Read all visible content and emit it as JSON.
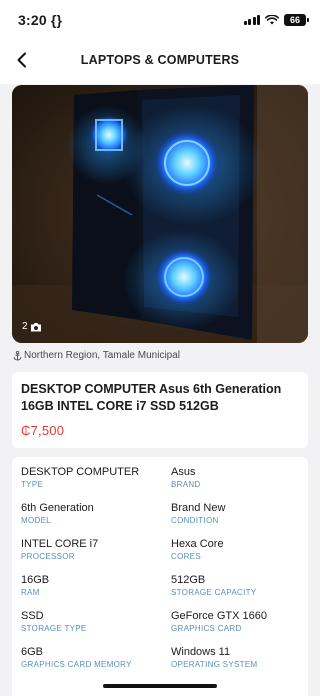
{
  "status_bar": {
    "time": "3:20 {}",
    "battery": "66"
  },
  "header": {
    "title": "LAPTOPS & COMPUTERS",
    "back_icon": "chevron-left-icon"
  },
  "photo": {
    "count": "2",
    "camera_icon": "camera-icon"
  },
  "location": {
    "text": "Northern Region, Tamale Municipal",
    "icon": "location-anchor-icon"
  },
  "listing": {
    "title": "DESKTOP COMPUTER Asus 6th Generation 16GB INTEL CORE i7 SSD 512GB",
    "price": "₵7,500",
    "price_color": "#e53935"
  },
  "specs": [
    {
      "value": "DESKTOP COMPUTER",
      "label": "TYPE"
    },
    {
      "value": "Asus",
      "label": "BRAND"
    },
    {
      "value": "6th Generation",
      "label": "MODEL"
    },
    {
      "value": "Brand New",
      "label": "CONDITION"
    },
    {
      "value": "INTEL CORE i7",
      "label": "PROCESSOR"
    },
    {
      "value": "Hexa Core",
      "label": "CORES"
    },
    {
      "value": "16GB",
      "label": "RAM"
    },
    {
      "value": "512GB",
      "label": "STORAGE CAPACITY"
    },
    {
      "value": "SSD",
      "label": "STORAGE TYPE"
    },
    {
      "value": "GeForce GTX 1660",
      "label": "GRAPHICS CARD"
    },
    {
      "value": "6GB",
      "label": "GRAPHICS CARD MEMORY"
    },
    {
      "value": "Windows 11",
      "label": "OPERATING SYSTEM"
    }
  ],
  "colors": {
    "accent_label": "#5a8fc0",
    "background": "#f2f2f4"
  }
}
